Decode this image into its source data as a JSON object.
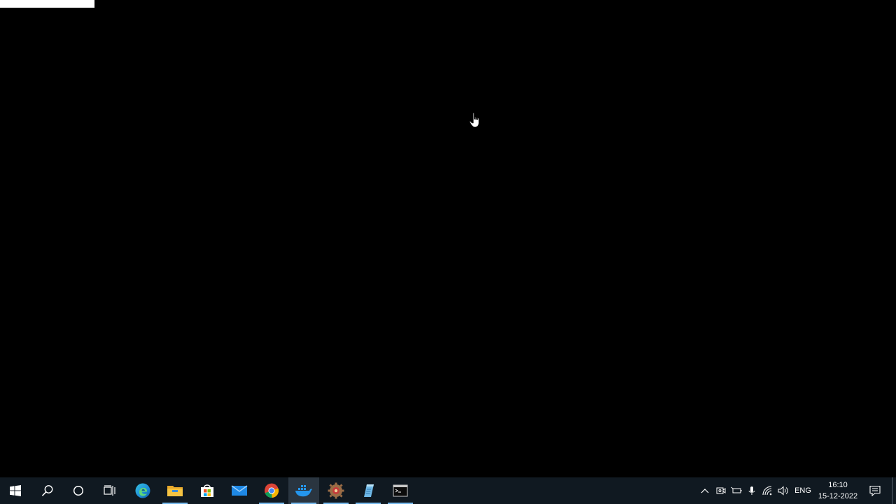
{
  "screen": {
    "background": "#000000"
  },
  "taskbar": {
    "background": "#101921",
    "accent": "#76b9ed",
    "buttons": [
      {
        "name": "start-button",
        "icon": "windows-logo-icon"
      },
      {
        "name": "search-button",
        "icon": "search-icon"
      },
      {
        "name": "cortana-button",
        "icon": "cortana-circle-icon"
      },
      {
        "name": "task-view-button",
        "icon": "task-view-icon"
      },
      {
        "name": "edge-button",
        "icon": "edge-icon"
      },
      {
        "name": "file-explorer-button",
        "icon": "folder-icon"
      },
      {
        "name": "store-button",
        "icon": "store-icon"
      },
      {
        "name": "mail-button",
        "icon": "mail-icon"
      },
      {
        "name": "chrome-button",
        "icon": "chrome-icon"
      },
      {
        "name": "docker-button",
        "icon": "docker-whale-icon",
        "active": true
      },
      {
        "name": "app-gear-button",
        "icon": "gear-app-icon"
      },
      {
        "name": "notepad-button",
        "icon": "notepad-icon"
      },
      {
        "name": "terminal-button",
        "icon": "terminal-icon"
      }
    ],
    "tray": {
      "language": "ENG",
      "time": "16:10",
      "date": "15-12-2022"
    }
  }
}
